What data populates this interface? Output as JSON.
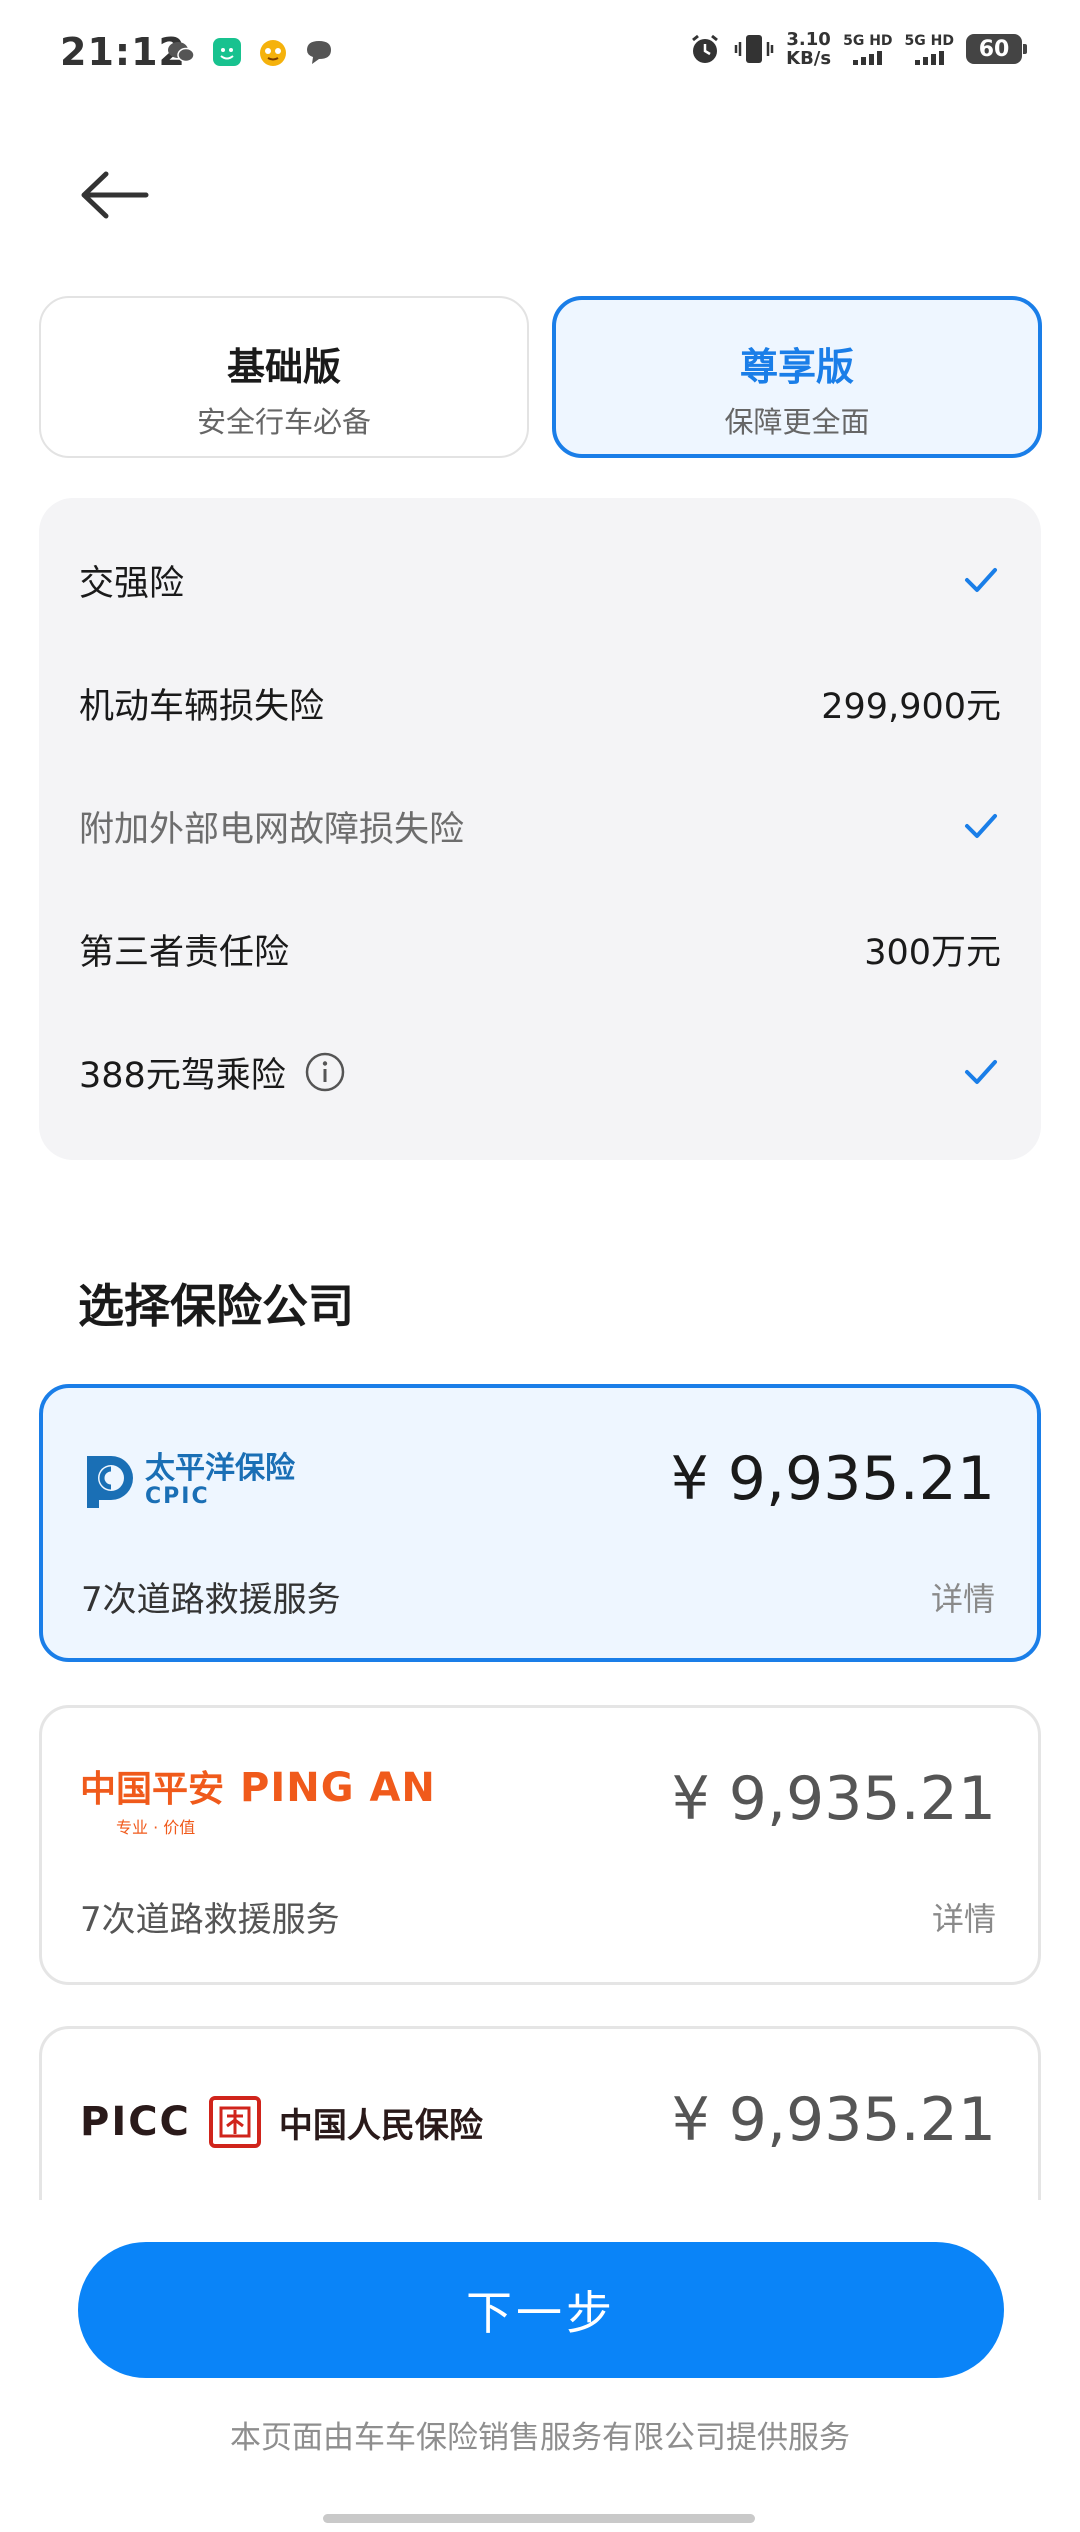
{
  "status_bar": {
    "time": "21:12",
    "net_speed_value": "3.10",
    "net_speed_unit": "KB/s",
    "sim1": "5G HD",
    "sim2": "5G HD",
    "battery": "60"
  },
  "plans": [
    {
      "title": "基础版",
      "subtitle": "安全行车必备",
      "selected": false
    },
    {
      "title": "尊享版",
      "subtitle": "保障更全面",
      "selected": true
    }
  ],
  "coverage": [
    {
      "name": "交强险",
      "value": "",
      "check": true,
      "muted": false
    },
    {
      "name": "机动车辆损失险",
      "value": "299,900元",
      "check": false,
      "muted": false
    },
    {
      "name": "附加外部电网故障损失险",
      "value": "",
      "check": true,
      "muted": true
    },
    {
      "name": "第三者责任险",
      "value": "300万元",
      "check": false,
      "muted": false
    },
    {
      "name": "388元驾乘险",
      "value": "",
      "check": true,
      "muted": false,
      "info": true
    }
  ],
  "section_title": "选择保险公司",
  "companies": [
    {
      "logo_cn": "太平洋保险",
      "logo_en": "CPIC",
      "price": "¥ 9,935.21",
      "benefit": "7次道路救援服务",
      "detail": "详情",
      "selected": true
    },
    {
      "logo_cn": "中国平安",
      "logo_en": "PING AN",
      "logo_slogan": "专业 · 价值",
      "price": "¥ 9,935.21",
      "benefit": "7次道路救援服务",
      "detail": "详情",
      "selected": false
    },
    {
      "logo_cn": "中国人民保险",
      "logo_en": "PICC",
      "price": "¥ 9,935.21",
      "selected": false
    }
  ],
  "next_button": "下一步",
  "footer_note": "本页面由车车保险销售服务有限公司提供服务",
  "colors": {
    "accent": "#1a7ee8",
    "button": "#0a84f8",
    "pingan": "#f05a1b",
    "picc": "#d0241b",
    "cpic": "#1a6fb5"
  }
}
